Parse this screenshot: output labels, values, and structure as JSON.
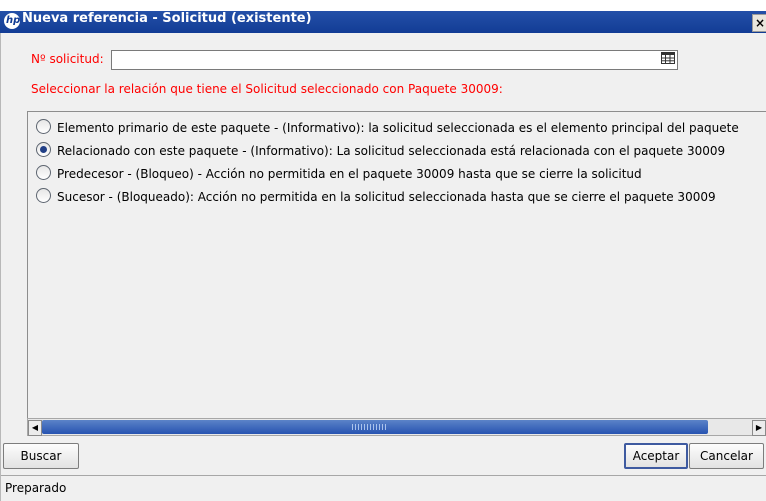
{
  "window": {
    "title": "Nueva referencia - Solicitud (existente)",
    "close_label": "×"
  },
  "form": {
    "request_label": "Nº solicitud:",
    "request_value": "",
    "instruction": "Seleccionar la relación que tiene el Solicitud seleccionado con Paquete 30009:"
  },
  "options": [
    {
      "label": "Elemento primario de este paquete - (Informativo): la solicitud seleccionada es el elemento principal del paquete",
      "selected": false
    },
    {
      "label": "Relacionado con este paquete - (Informativo): La solicitud seleccionada está relacionada con el paquete 30009",
      "selected": true
    },
    {
      "label": "Predecesor - (Bloqueo) - Acción no permitida en el paquete 30009 hasta que se cierre la solicitud",
      "selected": false
    },
    {
      "label": "Sucesor - (Bloqueado): Acción no permitida en la solicitud seleccionada hasta que se cierre el paquete 30009",
      "selected": false
    }
  ],
  "scrollbar": {
    "left_arrow": "◀",
    "right_arrow": "▶"
  },
  "buttons": {
    "search": "Buscar",
    "accept": "Aceptar",
    "cancel": "Cancelar"
  },
  "status": {
    "text": "Preparado"
  },
  "icons": {
    "app": "hp-logo-icon",
    "lookup": "calendar-list-icon"
  },
  "colors": {
    "title_bar": "#123c95",
    "label": "#ff0000",
    "accent": "#2753b1"
  }
}
